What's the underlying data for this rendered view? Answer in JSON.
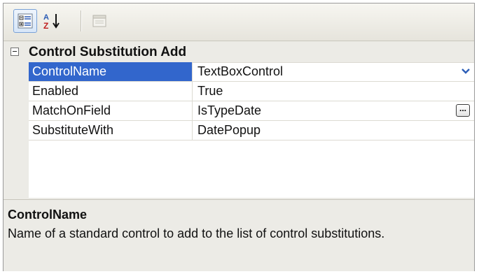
{
  "toolbar": {
    "buttons": [
      {
        "icon": "categorized-icon",
        "selected": true
      },
      {
        "icon": "alphabetical-sort-icon",
        "selected": false
      },
      {
        "icon": "property-pages-icon",
        "selected": false,
        "disabled": true
      }
    ]
  },
  "category": {
    "label": "Control Substitution Add",
    "expanded": true
  },
  "properties": [
    {
      "name": "ControlName",
      "value": "TextBoxControl",
      "selected": true,
      "editor": "dropdown"
    },
    {
      "name": "Enabled",
      "value": "True",
      "selected": false,
      "editor": "none"
    },
    {
      "name": "MatchOnField",
      "value": "IsTypeDate",
      "selected": false,
      "editor": "ellipsis"
    },
    {
      "name": "SubstituteWith",
      "value": "DatePopup",
      "selected": false,
      "editor": "none"
    }
  ],
  "ellipsis_label": "...",
  "description": {
    "title": "ControlName",
    "text": "Name of a standard control to add to the list of control substitutions."
  },
  "colors": {
    "selection": "#3266cc",
    "background": "#ecebe6",
    "grid_line": "#dcdad2"
  }
}
